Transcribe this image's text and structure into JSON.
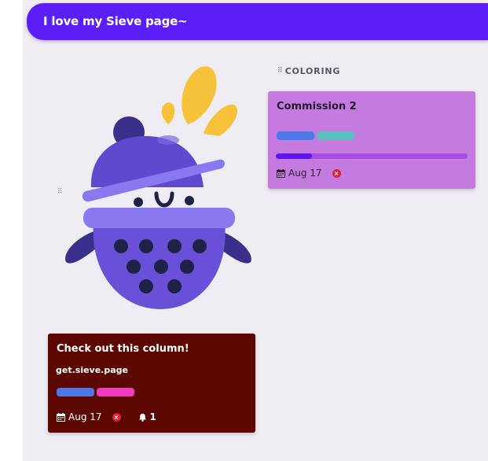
{
  "header": {
    "title": "I love my Sieve page~"
  },
  "column": {
    "title": "COLORING"
  },
  "cards": {
    "commission": {
      "title": "Commission 2",
      "labels": [
        {
          "color": "#4d78e8"
        },
        {
          "color": "#5bbfc0"
        }
      ],
      "progress": 0.19,
      "date": "Aug 17"
    },
    "featured": {
      "title": "Check out this column!",
      "subtitle": "get.sieve.page",
      "labels": [
        {
          "color": "#4d78e8"
        },
        {
          "color": "#f03ac1"
        }
      ],
      "date": "Aug 17",
      "notifications": "1"
    }
  },
  "colors": {
    "header": "#5b1ef6",
    "purple_card": "#c57ae0",
    "red_card": "#5c0800",
    "background": "#efedf3"
  },
  "icons": [
    "drag-handle-icon",
    "calendar-icon",
    "status-x-icon",
    "bell-icon",
    "sieve-mascot"
  ]
}
